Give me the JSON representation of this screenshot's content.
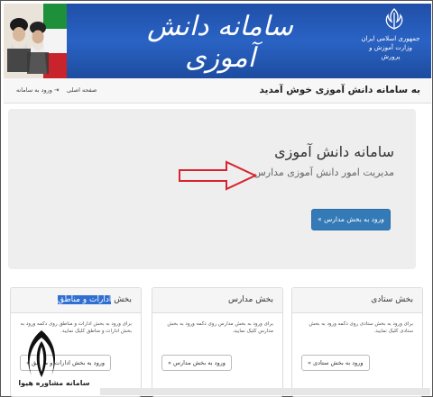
{
  "banner": {
    "title": "سامانه دانش آموزی",
    "ministry": "جمهوری اسلامی ایران\nوزارت آموزش و پرورش",
    "colors": {
      "background": "#2a63c4",
      "flag_green": "#1e8f3a",
      "flag_red": "#c8242b"
    },
    "emblem_icon": "iran-emblem-icon"
  },
  "navbar": {
    "brand": "به سامانه دانش آموزی خوش آمدید",
    "links": [
      {
        "label": "ورود به سامانه",
        "icon": "login-icon"
      },
      {
        "label": "صفحه اصلی"
      }
    ]
  },
  "hero": {
    "title": "سامانه دانش آموزی",
    "subtitle": "مدیریت امور دانش آموزی مدارس",
    "button": "ورود به بخش مدارس »",
    "accent_color": "#337ab7",
    "annotation_arrow_color": "#d9232e"
  },
  "cards": [
    {
      "heading": "بخش ستادی",
      "body": "برای ورود به بخش ستادی روی دکمه ورود به بخش ستادی کلیک نمایید.",
      "button": "ورود به بخش ستادی »"
    },
    {
      "heading": "بخش مدارس",
      "body": "برای ورود به بخش مدارس روی دکمه ورود به بخش مدارس کلیک نمایید.",
      "button": "ورود به بخش مدارس »"
    },
    {
      "heading": "بخش ادارات و مناطق",
      "heading_highlight": "ادارات و مناطق",
      "heading_prefix": "بخش",
      "body": "برای ورود به بخش ادارات و مناطق روی دکمه ورود به بخش ادارات و مناطق کلیک نمایید.",
      "button": "ورود به بخش ادارات و مناطق »"
    }
  ],
  "watermark": {
    "text": "سامانه مشاوره هیوا"
  }
}
